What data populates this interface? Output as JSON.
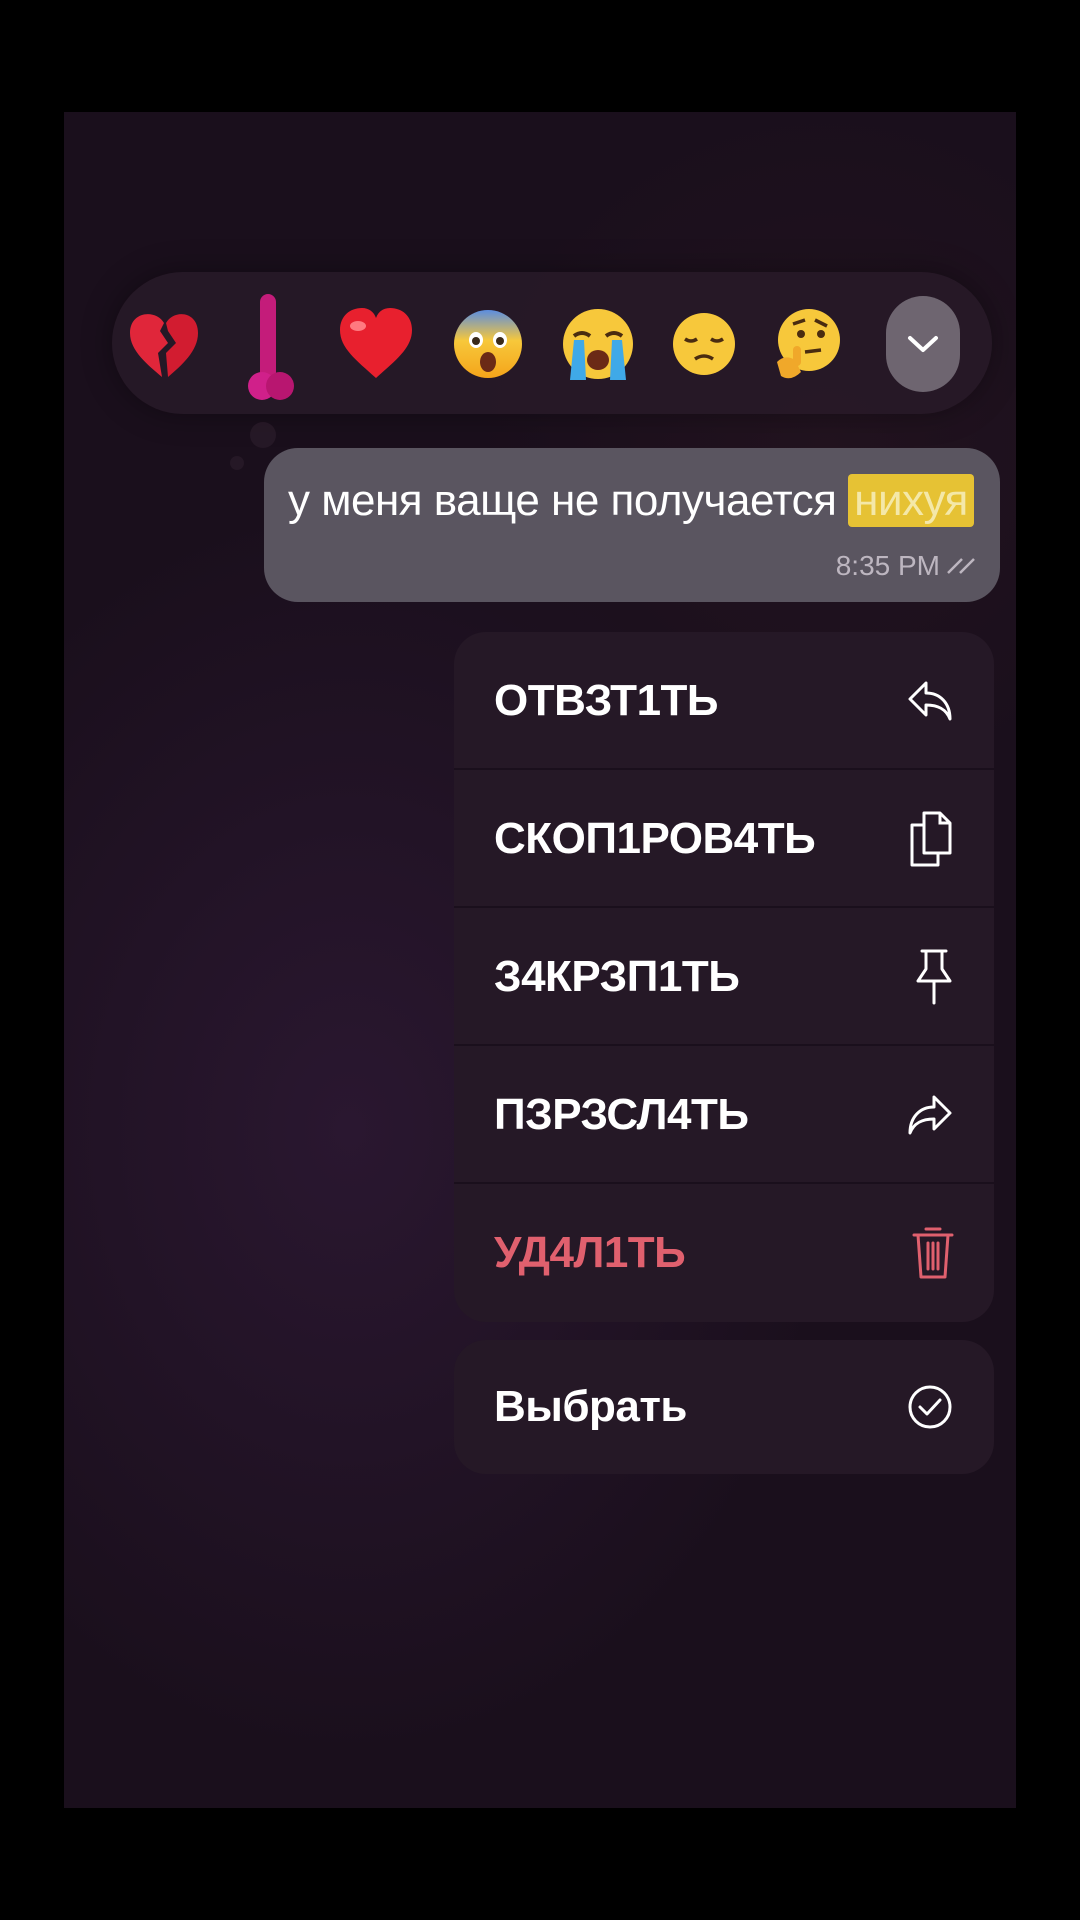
{
  "reactions": [
    {
      "name": "broken-heart",
      "emoji": "💔"
    },
    {
      "name": "eggplant-like",
      "emoji": "🍆"
    },
    {
      "name": "red-heart",
      "emoji": "❤️"
    },
    {
      "name": "fearful-face",
      "emoji": "😨"
    },
    {
      "name": "crying-face",
      "emoji": "😭"
    },
    {
      "name": "disappointed-face",
      "emoji": "😔"
    },
    {
      "name": "thinking-face",
      "emoji": "🤔"
    }
  ],
  "message": {
    "text_main": "у меня ваще не получается ",
    "text_highlight": "нихуя",
    "time": "8:35 PM"
  },
  "menu": {
    "items": [
      {
        "label": "ОТВЗТ1ТЬ",
        "icon": "reply-icon"
      },
      {
        "label": "СКОП1РОВ4ТЬ",
        "icon": "copy-icon"
      },
      {
        "label": "З4КРЗП1ТЬ",
        "icon": "pin-icon"
      },
      {
        "label": "ПЗРЗСЛ4ТЬ",
        "icon": "forward-icon"
      },
      {
        "label": "УД4Л1ТЬ",
        "icon": "trash-icon"
      }
    ],
    "select": {
      "label": "Выбрать",
      "icon": "check-circle-icon"
    }
  },
  "colors": {
    "danger": "#e0606e",
    "highlight": "#e6c234",
    "bubble": "#5a5560"
  }
}
